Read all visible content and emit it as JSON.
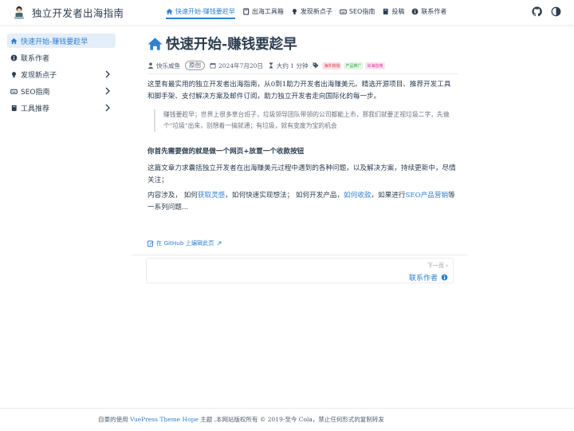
{
  "brand": {
    "title": "独立开发者出海指南"
  },
  "nav": {
    "items": [
      {
        "label": "快速开始-赚钱要趁早",
        "icon": "home-icon",
        "active": true
      },
      {
        "label": "出海工具箱",
        "icon": "book-icon"
      },
      {
        "label": "发现新点子",
        "icon": "lightbulb-icon"
      },
      {
        "label": "SEO指南",
        "icon": "keyboard-icon"
      },
      {
        "label": "投稿",
        "icon": "book-icon"
      },
      {
        "label": "联系作者",
        "icon": "info-icon"
      }
    ],
    "tools": [
      "github-icon",
      "theme-toggle-icon"
    ]
  },
  "sidebar": {
    "items": [
      {
        "label": "快速开始-赚钱要趁早",
        "icon": "home-icon",
        "active": true
      },
      {
        "label": "联系作者",
        "icon": "info-icon"
      },
      {
        "label": "发现新点子",
        "icon": "lightbulb-icon",
        "expandable": true
      },
      {
        "label": "SEO指南",
        "icon": "keyboard-icon",
        "expandable": true
      },
      {
        "label": "工具推荐",
        "icon": "book-icon",
        "expandable": true
      }
    ]
  },
  "article": {
    "title": "快速开始-赚钱要趁早",
    "meta": {
      "author": "快乐咸鱼",
      "original": "原创",
      "date": "2024年7月20日",
      "reading": "大约 1 分钟",
      "tags": [
        "海外搞钱",
        "产品推广",
        "出海指南"
      ]
    },
    "intro": "这里有最实用的独立开发者出海指南，从0到1助力开发者出海赚美元。精选开源项目、推荐开发工具和脚手架、支付解决方案及邮件订阅，助力独立开发者走向国际化的每一步。",
    "quote": "赚钱要趁早；世界上很多草台班子，垃圾领导团队带领的公司都能上市，那我们就要正视垃圾二字，先做个\"垃圾\"出来，别想着一搞就通；有垃圾，就有变废为宝的机会",
    "heading": "你首先需要做的就是做一个网页+放置一个收款按钮",
    "para2": "这篇文章力求囊括独立开发者在出海赚美元过程中遇到的各种问题，以及解决方案，持续更新中，尽情关注；",
    "para3": {
      "t1": "内容涉及，  如何",
      "l1": "获取灵感",
      "t2": "，如何快速实现想法；  如何开发产品，",
      "l2": "如何收款",
      "t3": "，如果进行",
      "l3": "SEO产品营销",
      "t4": "等一系列问题..."
    }
  },
  "edit_link": "在 GitHub 上编辑此页",
  "next": {
    "hint": "下一页",
    "title": "联系作者"
  },
  "footer": {
    "before": "自豪的使用 ",
    "link": "VuePress Theme Hope",
    "after": " 主题 ,本网站版权所有 © 2019-至今 Cola，禁止任何形式的复制转发"
  },
  "colors": {
    "accent": "#2f80d0",
    "text": "#2c3e50"
  }
}
